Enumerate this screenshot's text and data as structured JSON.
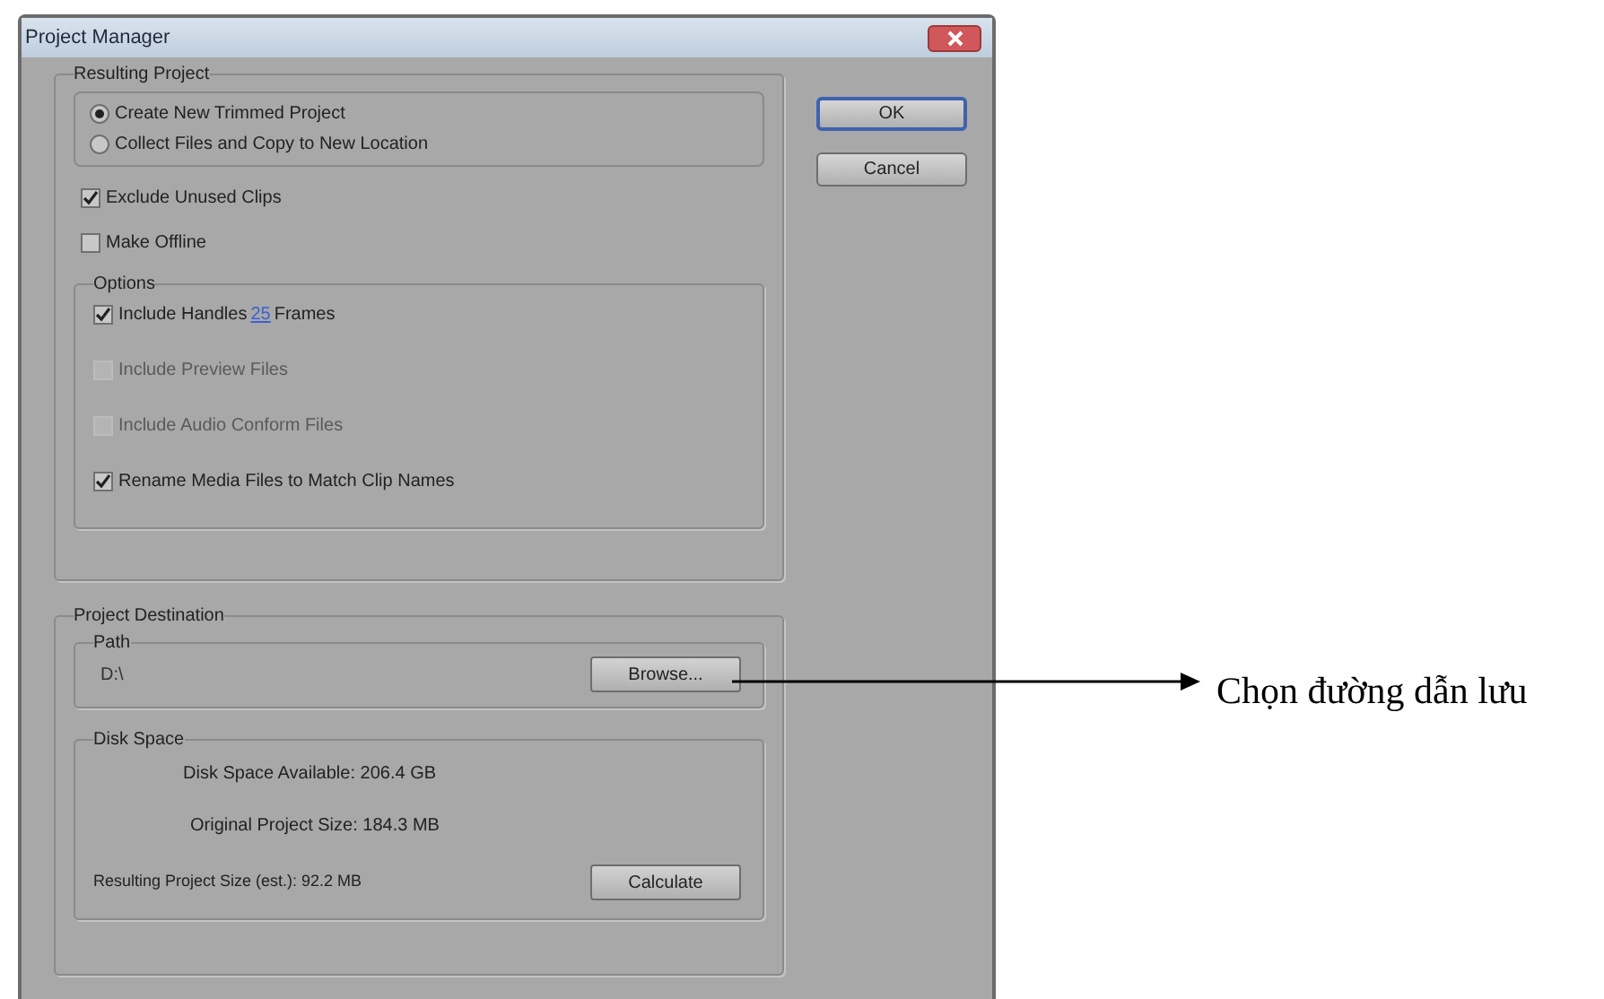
{
  "window": {
    "title": "Project Manager"
  },
  "resulting_project": {
    "title": "Resulting Project",
    "modes": [
      {
        "label": "Create New Trimmed Project",
        "selected": true
      },
      {
        "label": "Collect Files and Copy to New Location",
        "selected": false
      }
    ],
    "checkboxes": [
      {
        "label": "Exclude Unused Clips",
        "checked": true
      },
      {
        "label": "Make Offline",
        "checked": false
      }
    ],
    "options": {
      "title": "Options",
      "items": [
        {
          "kind": "handles",
          "label": "Include Handles",
          "value": "25",
          "unit": "Frames",
          "checked": true,
          "disabled": false
        },
        {
          "kind": "plain",
          "label": "Include Preview Files",
          "checked": false,
          "disabled": true
        },
        {
          "kind": "plain",
          "label": "Include Audio Conform Files",
          "checked": false,
          "disabled": true
        },
        {
          "kind": "plain",
          "label": "Rename Media Files to Match Clip Names",
          "checked": true,
          "disabled": false
        }
      ]
    }
  },
  "destination": {
    "title": "Project Destination",
    "path": {
      "title": "Path",
      "value": "D:\\",
      "button": "Browse..."
    },
    "disk_space": {
      "title": "Disk Space",
      "available": "Disk Space Available: 206.4 GB",
      "original": "Original Project Size: 184.3 MB",
      "resulting": "Resulting Project Size (est.): 92.2 MB",
      "button": "Calculate"
    }
  },
  "buttons": [
    {
      "label": "OK",
      "default": true
    },
    {
      "label": "Cancel",
      "default": false
    }
  ],
  "annotation": {
    "text": "Chọn đường dẫn lưu"
  }
}
